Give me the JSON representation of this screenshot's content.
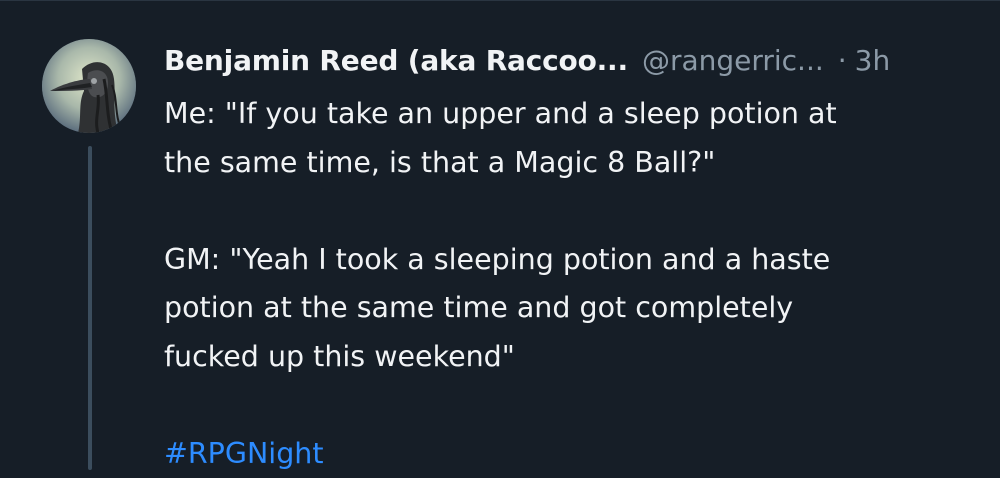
{
  "post": {
    "author_name": "Benjamin Reed (aka Raccoo...",
    "handle": "@rangerric...",
    "separator": "·",
    "time": "3h",
    "avatar_icon": "plague-doctor-avatar-icon",
    "text_lines": [
      "Me: \"If you take an upper and a sleep potion at",
      "the same time, is that a Magic 8 Ball?\"",
      "",
      "GM: \"Yeah I took a sleeping potion and a haste",
      "potion at the same time and got completely",
      "fucked up this weekend\""
    ],
    "hashtag": "#RPGNight"
  },
  "colors": {
    "background": "#161e27",
    "text": "#f1f3f5",
    "muted": "#8c9aa7",
    "link": "#2d8cff",
    "thread_line": "#3b4d5d"
  }
}
